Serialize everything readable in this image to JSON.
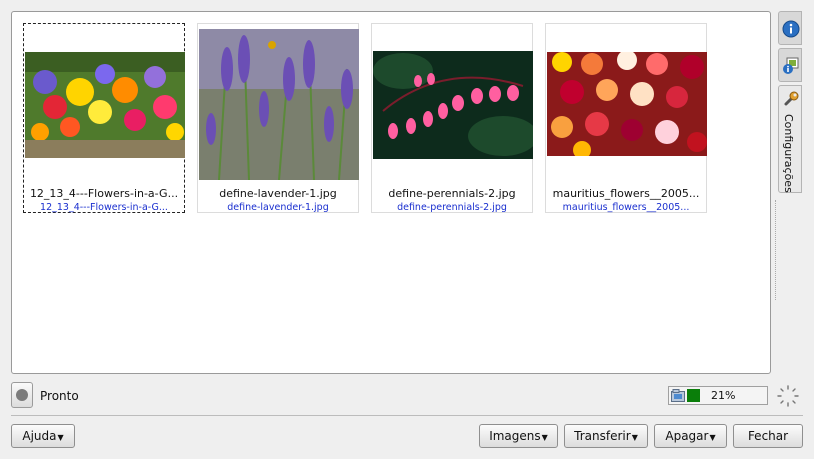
{
  "thumbnails": [
    {
      "name": "12_13_4---Flowers-in-a-G...",
      "subtitle": "12_13_4---Flowers-in-a-G...",
      "selected": true
    },
    {
      "name": "define-lavender-1.jpg",
      "subtitle": "define-lavender-1.jpg",
      "selected": false
    },
    {
      "name": "define-perennials-2.jpg",
      "subtitle": "define-perennials-2.jpg",
      "selected": false
    },
    {
      "name": "mauritius_flowers__2005...",
      "subtitle": "mauritius_flowers__2005...",
      "selected": false
    }
  ],
  "sidebar": {
    "tabs": [
      {
        "icon": "info-icon"
      },
      {
        "icon": "image-info-icon"
      },
      {
        "icon": "wrench-icon",
        "label": "Configurações"
      }
    ]
  },
  "status": {
    "text": "Pronto"
  },
  "progress": {
    "value": 0.21,
    "label": "21%"
  },
  "buttons": {
    "help": {
      "label": "Ajuda",
      "accel": "A"
    },
    "images": {
      "label": "Imagens",
      "accel": "I"
    },
    "transfer": {
      "label": "Transferir",
      "accel": "T"
    },
    "delete": {
      "label": "Apagar",
      "accel": "p"
    },
    "close": {
      "label": "Fechar",
      "accel": "F"
    }
  },
  "colors": {
    "subtitle_text": "#1a2fcf",
    "progress_fill": "#0a7e0a",
    "sidebar_icon": "#2a6fc2"
  }
}
